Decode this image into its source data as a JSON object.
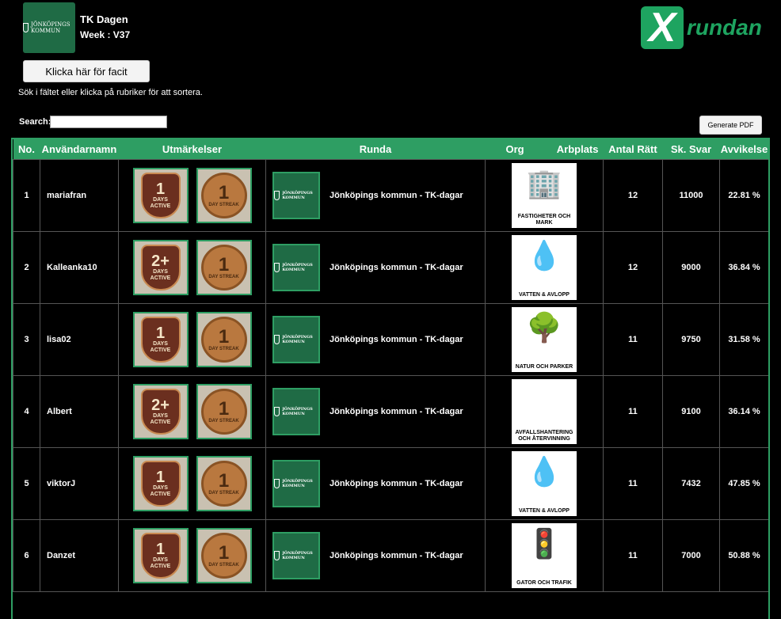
{
  "header": {
    "kommun_logo_text": "JÖNKÖPINGS KOMMUN",
    "title": "TK Dagen",
    "week": "Week : V37",
    "brand_x": "X",
    "brand_rundan": "rundan"
  },
  "controls": {
    "facit_button": "Klicka här för facit",
    "hint": "Sök i fältet eller klicka på rubriker för att sortera.",
    "search_label": "Search:",
    "search_value": "",
    "pdf_button": "Generate PDF"
  },
  "table": {
    "headers": {
      "no": "No.",
      "user": "Användarnamn",
      "awards": "Utmärkelser",
      "runda": "Runda",
      "org": "Org",
      "arbplats": "Arbplats",
      "antal": "Antal Rätt",
      "svar": "Sk. Svar",
      "avvikelse": "Avvikelse"
    },
    "rows": [
      {
        "no": "1",
        "user": "mariafran",
        "badge1_num": "1",
        "badge1_label": "DAYS ACTIVE",
        "badge2_num": "1",
        "badge2_label": "DAY STREAK",
        "runda": "Jönköpings kommun - TK-dagar",
        "arb_icon": "🏢",
        "arb_label": "FASTIGHETER OCH MARK",
        "antal": "12",
        "svar": "11000",
        "avvikelse": "22.81 %"
      },
      {
        "no": "2",
        "user": "Kalleanka10",
        "badge1_num": "2+",
        "badge1_label": "DAYS ACTIVE",
        "badge2_num": "1",
        "badge2_label": "DAY STREAK",
        "runda": "Jönköpings kommun - TK-dagar",
        "arb_icon": "💧",
        "arb_label": "VATTEN & AVLOPP",
        "antal": "12",
        "svar": "9000",
        "avvikelse": "36.84 %"
      },
      {
        "no": "3",
        "user": "lisa02",
        "badge1_num": "1",
        "badge1_label": "DAYS ACTIVE",
        "badge2_num": "1",
        "badge2_label": "DAY STREAK",
        "runda": "Jönköpings kommun - TK-dagar",
        "arb_icon": "🌳",
        "arb_label": "NATUR OCH PARKER",
        "antal": "11",
        "svar": "9750",
        "avvikelse": "31.58 %"
      },
      {
        "no": "4",
        "user": "Albert",
        "badge1_num": "2+",
        "badge1_label": "DAYS ACTIVE",
        "badge2_num": "1",
        "badge2_label": "DAY STREAK",
        "runda": "Jönköpings kommun - TK-dagar",
        "arb_icon": "♻",
        "arb_label": "AVFALLSHANTERING OCH ÅTERVINNING",
        "antal": "11",
        "svar": "9100",
        "avvikelse": "36.14 %"
      },
      {
        "no": "5",
        "user": "viktorJ",
        "badge1_num": "1",
        "badge1_label": "DAYS ACTIVE",
        "badge2_num": "1",
        "badge2_label": "DAY STREAK",
        "runda": "Jönköpings kommun - TK-dagar",
        "arb_icon": "💧",
        "arb_label": "VATTEN & AVLOPP",
        "antal": "11",
        "svar": "7432",
        "avvikelse": "47.85 %"
      },
      {
        "no": "6",
        "user": "Danzet",
        "badge1_num": "1",
        "badge1_label": "DAYS ACTIVE",
        "badge2_num": "1",
        "badge2_label": "DAY STREAK",
        "runda": "Jönköpings kommun - TK-dagar",
        "arb_icon": "🚦",
        "arb_label": "GATOR OCH TRAFIK",
        "antal": "11",
        "svar": "7000",
        "avvikelse": "50.88 %"
      }
    ]
  }
}
